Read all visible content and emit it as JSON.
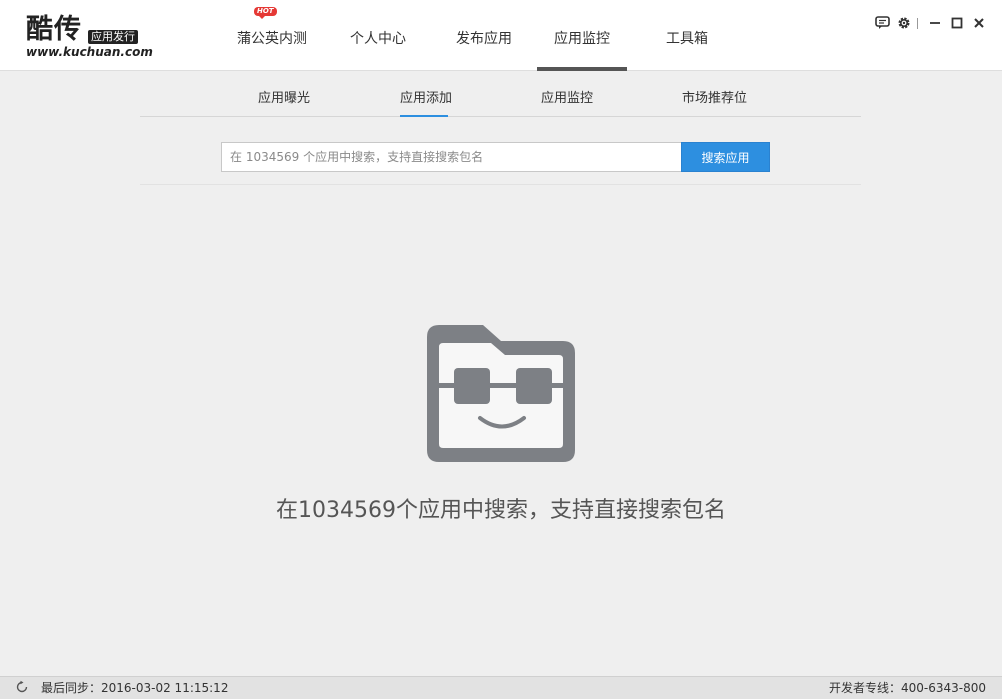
{
  "logo": {
    "main": "酷传",
    "tag": "应用发行",
    "url": "www.kuchuan.com"
  },
  "main_nav": [
    {
      "label": "蒲公英内测",
      "active": false
    },
    {
      "label": "个人中心",
      "active": false
    },
    {
      "label": "发布应用",
      "active": false
    },
    {
      "label": "应用监控",
      "active": true
    },
    {
      "label": "工具箱",
      "active": false
    }
  ],
  "window_controls": {
    "feedback_icon": "speech-bubble-icon",
    "settings_icon": "gear-icon",
    "minimize_glyph": "—",
    "maximize_glyph": "□",
    "close_glyph": "✕"
  },
  "sub_nav": {
    "hot_badge": "HOT",
    "items": [
      {
        "label": "应用曝光",
        "active": false
      },
      {
        "label": "应用添加",
        "active": true
      },
      {
        "label": "应用监控",
        "active": false
      },
      {
        "label": "市场推荐位",
        "active": false
      }
    ]
  },
  "search": {
    "placeholder": "在 1034569 个应用中搜索，支持直接搜索包名",
    "value": "",
    "button_label": "搜索应用"
  },
  "empty_state": {
    "icon": "folder-robot-face-icon",
    "message": "在1034569个应用中搜索，支持直接搜索包名"
  },
  "status_bar": {
    "sync_icon": "refresh-icon",
    "last_sync": "最后同步：2016-03-02 11:15:12",
    "hotline": "开发者专线：400-6343-800"
  },
  "colors": {
    "accent": "#2d8fe0",
    "hot_badge": "#e53935",
    "icon_gray": "#7d8085"
  }
}
